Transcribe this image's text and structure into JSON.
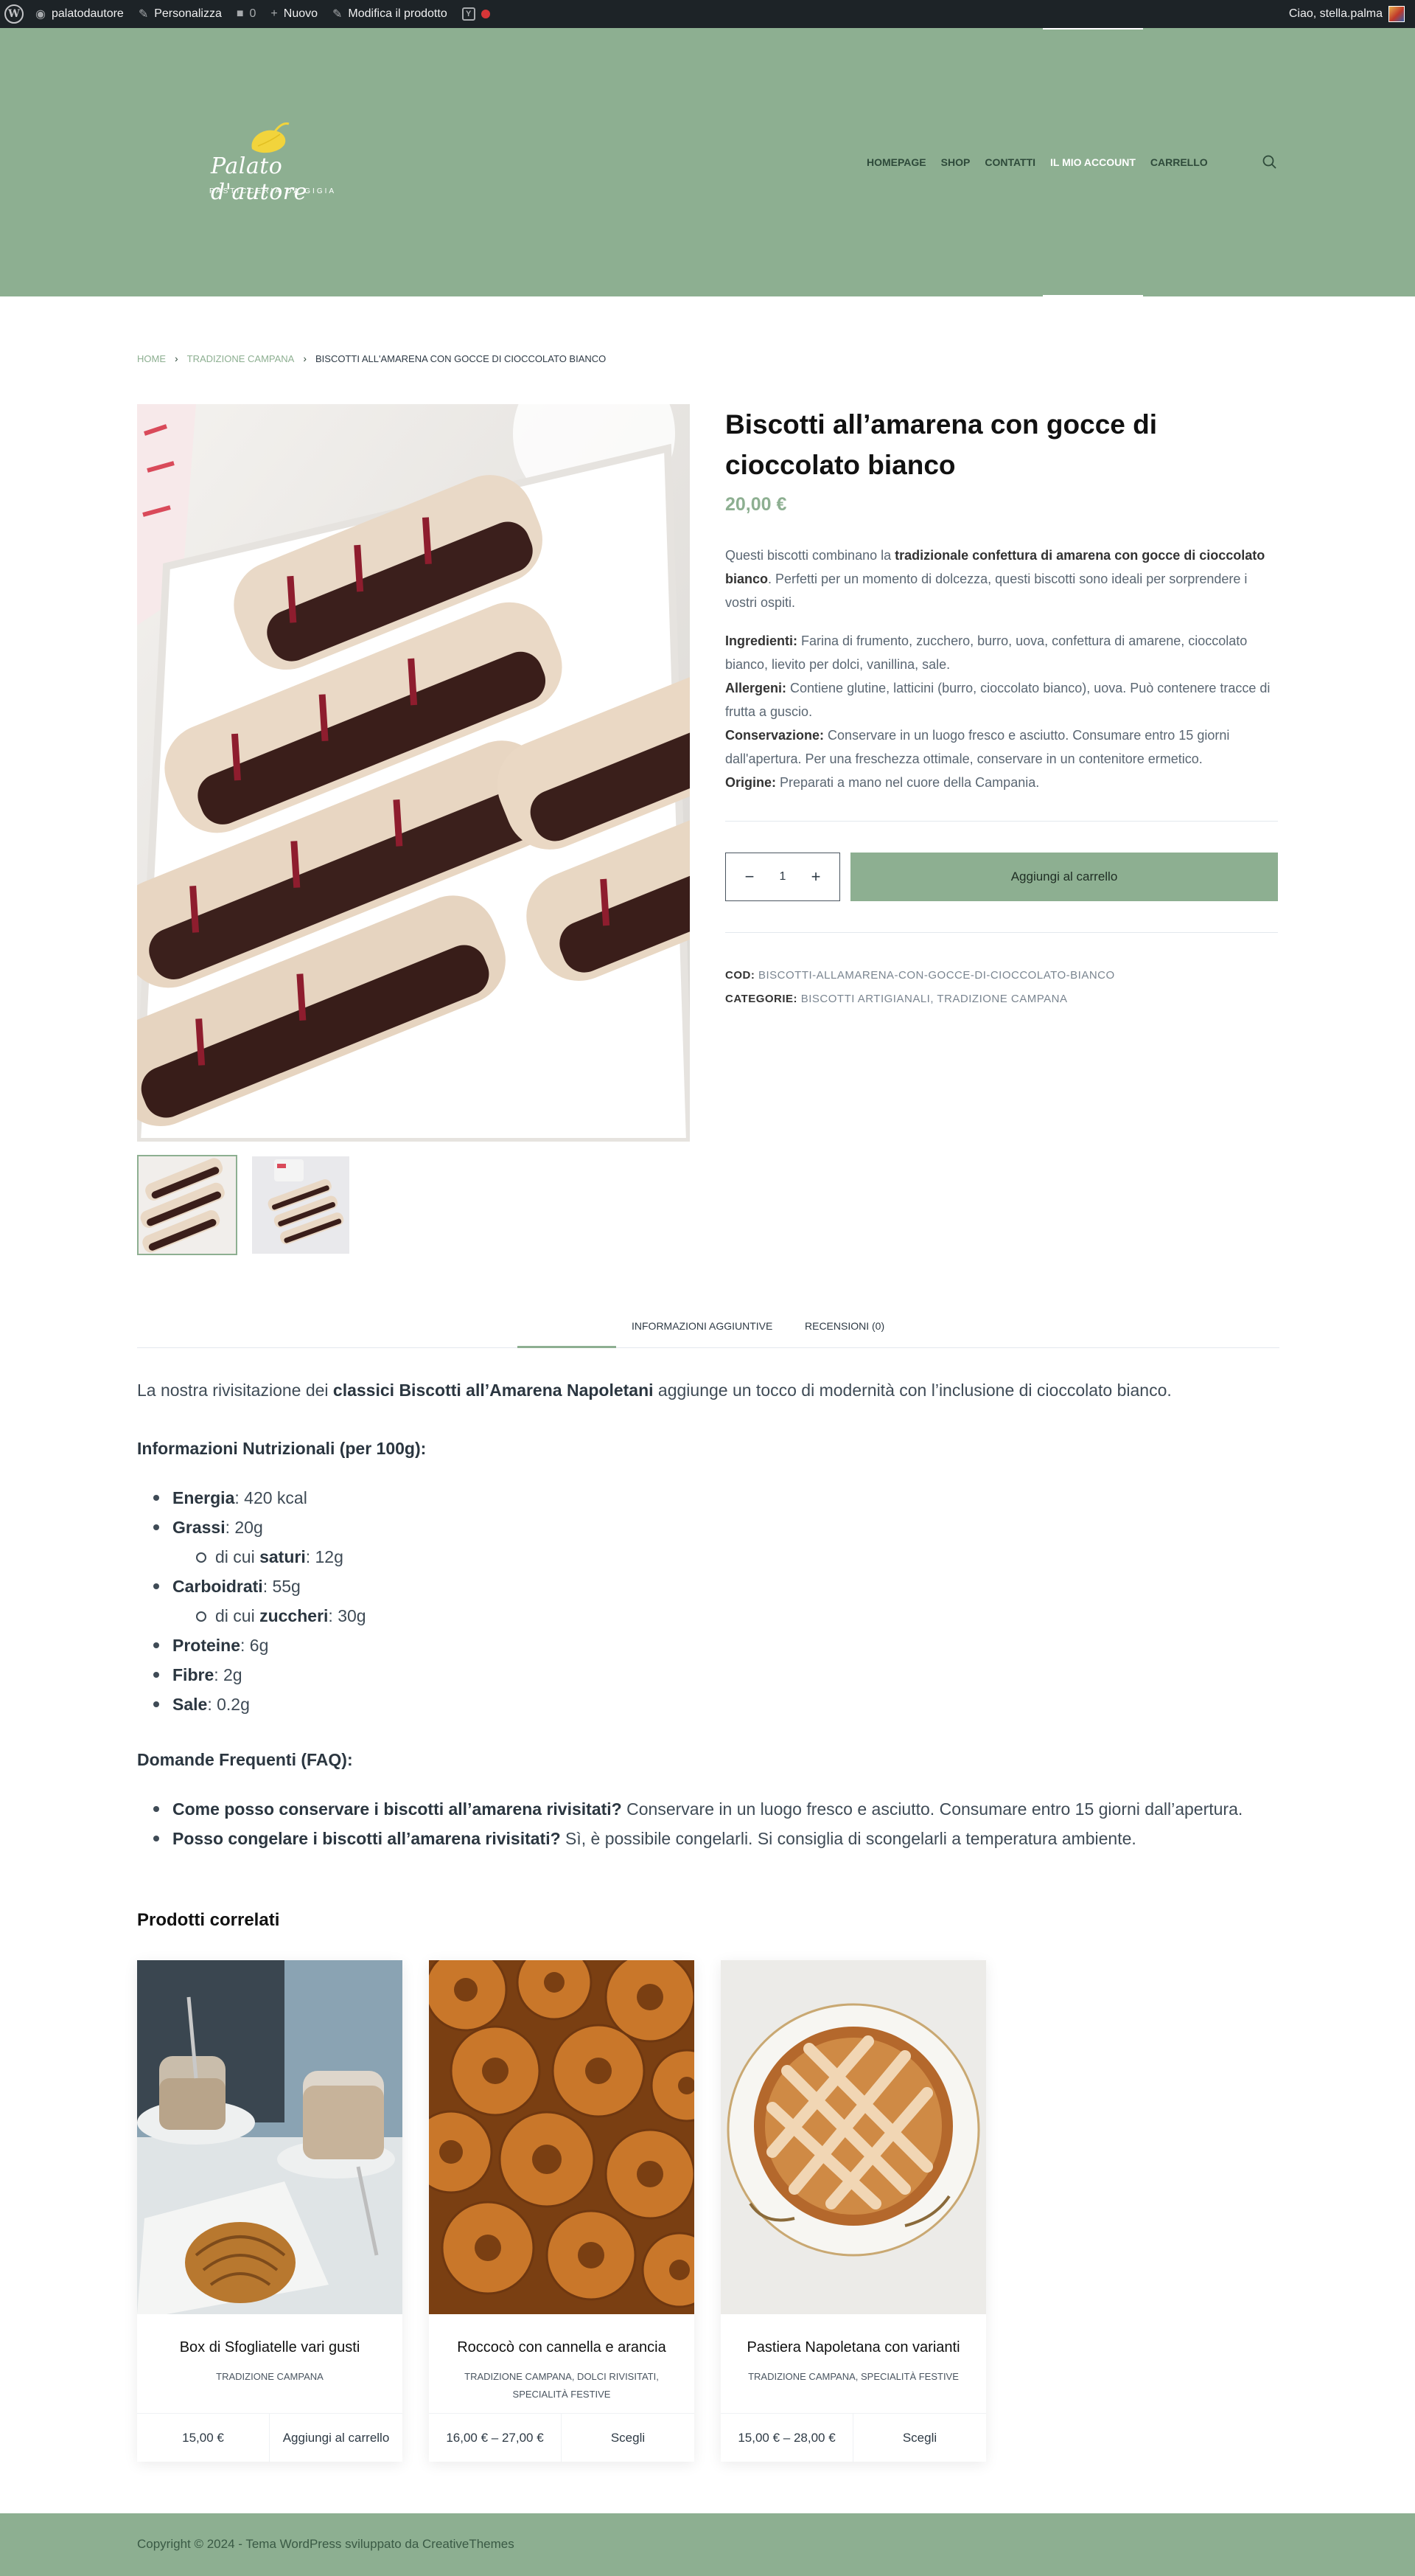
{
  "adminbar": {
    "site_name": "palatodautore",
    "customize": "Personalizza",
    "comments": "0",
    "new": "Nuovo",
    "edit": "Modifica il prodotto",
    "greeting": "Ciao, stella.palma"
  },
  "header": {
    "logo_script": "Palato d'autore",
    "logo_subtitle": "PASTICCERIA DA GIGIA",
    "nav": [
      "HOMEPAGE",
      "SHOP",
      "CONTATTI",
      "IL MIO ACCOUNT",
      "CARRELLO"
    ],
    "active_nav": "IL MIO ACCOUNT",
    "accent_color": "#8daf91"
  },
  "breadcrumb": {
    "home": "HOME",
    "category": "TRADIZIONE CAMPANA",
    "current": "BISCOTTI ALL'AMARENA CON GOCCE DI CIOCCOLATO BIANCO"
  },
  "product": {
    "title": "Biscotti all’amarena con gocce di cioccolato bianco",
    "price": "20,00 €",
    "desc_1": "Questi biscotti combinano la ",
    "desc_bold": "tradizionale confettura di amarena con gocce di cioccolato bianco",
    "desc_2": ". Perfetti per un momento di dolcezza, questi biscotti sono ideali per sorprendere i vostri ospiti.",
    "ingredients_label": "Ingredienti:",
    "ingredients": " Farina di frumento, zucchero, burro, uova, confettura di amarene, cioccolato bianco, lievito per dolci, vanillina, sale.",
    "allergens_label": "Allergeni:",
    "allergens": " Contiene glutine, latticini (burro, cioccolato bianco), uova. Può contenere tracce di frutta a guscio.",
    "storage_label": "Conservazione:",
    "storage": " Conservare in un luogo fresco e asciutto. Consumare entro 15 giorni dall'apertura. Per una freschezza ottimale, conservare in un contenitore ermetico.",
    "origin_label": "Origine:",
    "origin": " Preparati a mano nel cuore della Campania.",
    "quantity": "1",
    "add_to_cart": "Aggiungi al carrello",
    "sku_label": "COD:",
    "sku": "BISCOTTI-ALLAMARENA-CON-GOCCE-DI-CIOCCOLATO-BIANCO",
    "categories_label": "CATEGORIE:",
    "category_1": "BISCOTTI ARTIGIANALI",
    "category_sep": ", ",
    "category_2": "TRADIZIONE CAMPANA"
  },
  "tabs": {
    "items": [
      "INFORMAZIONI AGGIUNTIVE",
      "RECENSIONI (0)"
    ],
    "intro_1": "La nostra rivisitazione dei ",
    "intro_bold": "classici Biscotti all’Amarena Napoletani",
    "intro_2": " aggiunge un tocco di modernità con l’inclusione di cioccolato bianco.",
    "nutri_title": "Informazioni Nutrizionali (per 100g):",
    "energy_label": "Energia",
    "energy": ": 420 kcal",
    "fat_label": "Grassi",
    "fat": ": 20g",
    "sat_pre": "di cui ",
    "sat_label": "saturi",
    "sat": ": 12g",
    "carbs_label": "Carboidrati",
    "carbs": ": 55g",
    "sugar_pre": "di cui ",
    "sugar_label": "zuccheri",
    "sugar": ": 30g",
    "protein_label": "Proteine",
    "protein": ": 6g",
    "fiber_label": "Fibre",
    "fiber": ": 2g",
    "salt_label": "Sale",
    "salt": ": 0.2g",
    "faq_title": "Domande Frequenti (FAQ):",
    "faq_q1": "Come posso conservare i biscotti all’amarena rivisitati?",
    "faq_a1": " Conservare in un luogo fresco e asciutto. Consumare entro 15 giorni dall’apertura.",
    "faq_q2": "Posso congelare i biscotti all’amarena rivisitati?",
    "faq_a2": " Sì, è possibile congelarli. Si consiglia di scongelarli a temperatura ambiente."
  },
  "related": {
    "title": "Prodotti correlati",
    "items": [
      {
        "name": "Box di Sfogliatelle vari gusti",
        "cats": "TRADIZIONE CAMPANA",
        "price": "15,00 €",
        "button": "Aggiungi al carrello"
      },
      {
        "name": "Roccocò con cannella e arancia",
        "cats": "TRADIZIONE CAMPANA, DOLCI RIVISITATI, SPECIALITÀ FESTIVE",
        "price": "16,00 € – 27,00 €",
        "button": "Scegli"
      },
      {
        "name": "Pastiera Napoletana con varianti",
        "cats": "TRADIZIONE CAMPANA, SPECIALITÀ FESTIVE",
        "price": "15,00 € – 28,00 €",
        "button": "Scegli"
      }
    ]
  },
  "footer": {
    "copyright": "Copyright © 2024 - Tema WordPress sviluppato da CreativeThemes"
  }
}
